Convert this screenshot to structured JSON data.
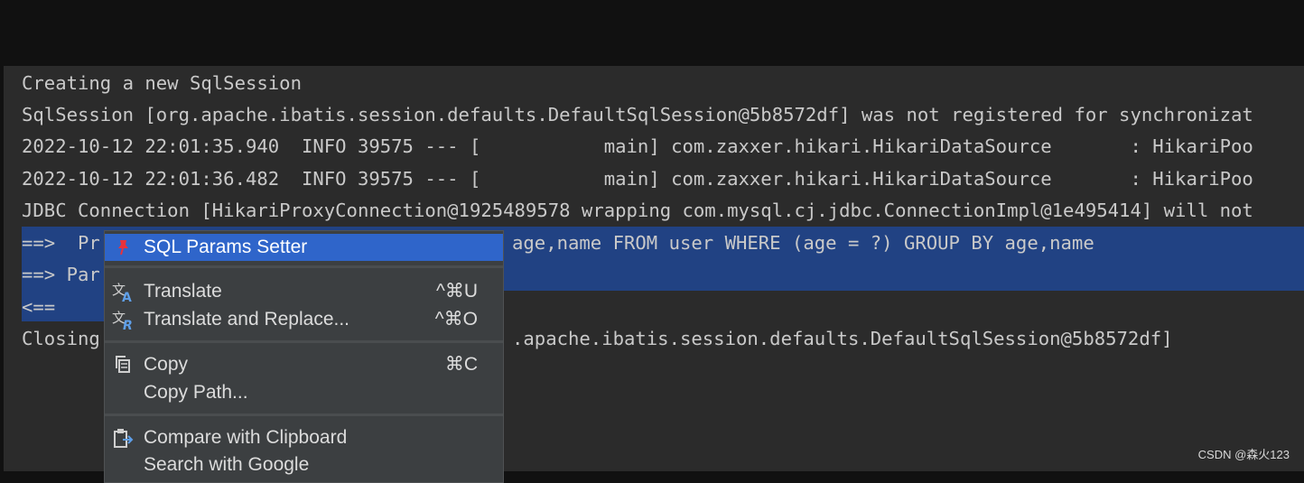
{
  "console": {
    "lines": [
      "Creating a new SqlSession",
      "SqlSession [org.apache.ibatis.session.defaults.DefaultSqlSession@5b8572df] was not registered for synchronizat",
      "2022-10-12 22:01:35.940  INFO 39575 --- [           main] com.zaxxer.hikari.HikariDataSource       : HikariPoo",
      "2022-10-12 22:01:36.482  INFO 39575 --- [           main] com.zaxxer.hikari.HikariDataSource       : HikariPoo",
      "JDBC Connection [HikariProxyConnection@1925489578 wrapping com.mysql.cj.jdbc.ConnectionImpl@1e495414] will not",
      "==>  Pr",
      "==> Par",
      "<==",
      "Closing"
    ],
    "line6_tail": "age,name FROM user WHERE (age = ?) GROUP BY age,name",
    "line9_tail": ".apache.ibatis.session.defaults.DefaultSqlSession@5b8572df]",
    "selection_color": "#214283"
  },
  "context_menu": {
    "items": [
      {
        "label": "SQL Params Setter",
        "shortcut": "",
        "icon": "sql-params-pin-icon",
        "highlighted": true
      },
      {
        "label": "Translate",
        "shortcut": "^⌘U",
        "icon": "translate-icon"
      },
      {
        "label": "Translate and Replace...",
        "shortcut": "^⌘O",
        "icon": "translate-replace-icon"
      },
      {
        "label": "Copy",
        "shortcut": "⌘C",
        "icon": "copy-icon"
      },
      {
        "label": "Copy Path...",
        "shortcut": "",
        "icon": ""
      },
      {
        "label": "Compare with Clipboard",
        "shortcut": "",
        "icon": "compare-clipboard-icon"
      },
      {
        "label": "Search with Google",
        "shortcut": "",
        "icon": ""
      }
    ],
    "highlight_color": "#2f65ca"
  },
  "watermark": "CSDN @森火123"
}
